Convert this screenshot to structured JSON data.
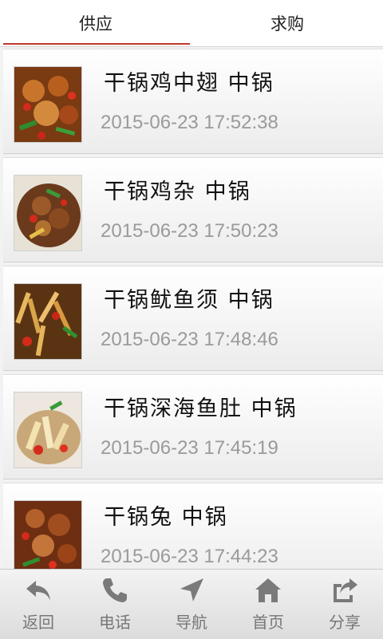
{
  "tabs": [
    {
      "label": "供应",
      "active": true
    },
    {
      "label": "求购",
      "active": false
    }
  ],
  "items": [
    {
      "title": "干锅鸡中翅 中锅",
      "date": "2015-06-23 17:52:38"
    },
    {
      "title": "干锅鸡杂 中锅",
      "date": "2015-06-23 17:50:23"
    },
    {
      "title": "干锅鱿鱼须 中锅",
      "date": "2015-06-23 17:48:46"
    },
    {
      "title": "干锅深海鱼肚 中锅",
      "date": "2015-06-23 17:45:19"
    },
    {
      "title": "干锅兔 中锅",
      "date": "2015-06-23 17:44:23"
    }
  ],
  "bottom_nav": [
    {
      "label": "返回",
      "icon": "back-icon"
    },
    {
      "label": "电话",
      "icon": "phone-icon"
    },
    {
      "label": "导航",
      "icon": "navigation-icon"
    },
    {
      "label": "首页",
      "icon": "home-icon"
    },
    {
      "label": "分享",
      "icon": "share-icon"
    }
  ],
  "colors": {
    "tab_indicator": "#c0392b",
    "icon": "#7a7a7a"
  }
}
